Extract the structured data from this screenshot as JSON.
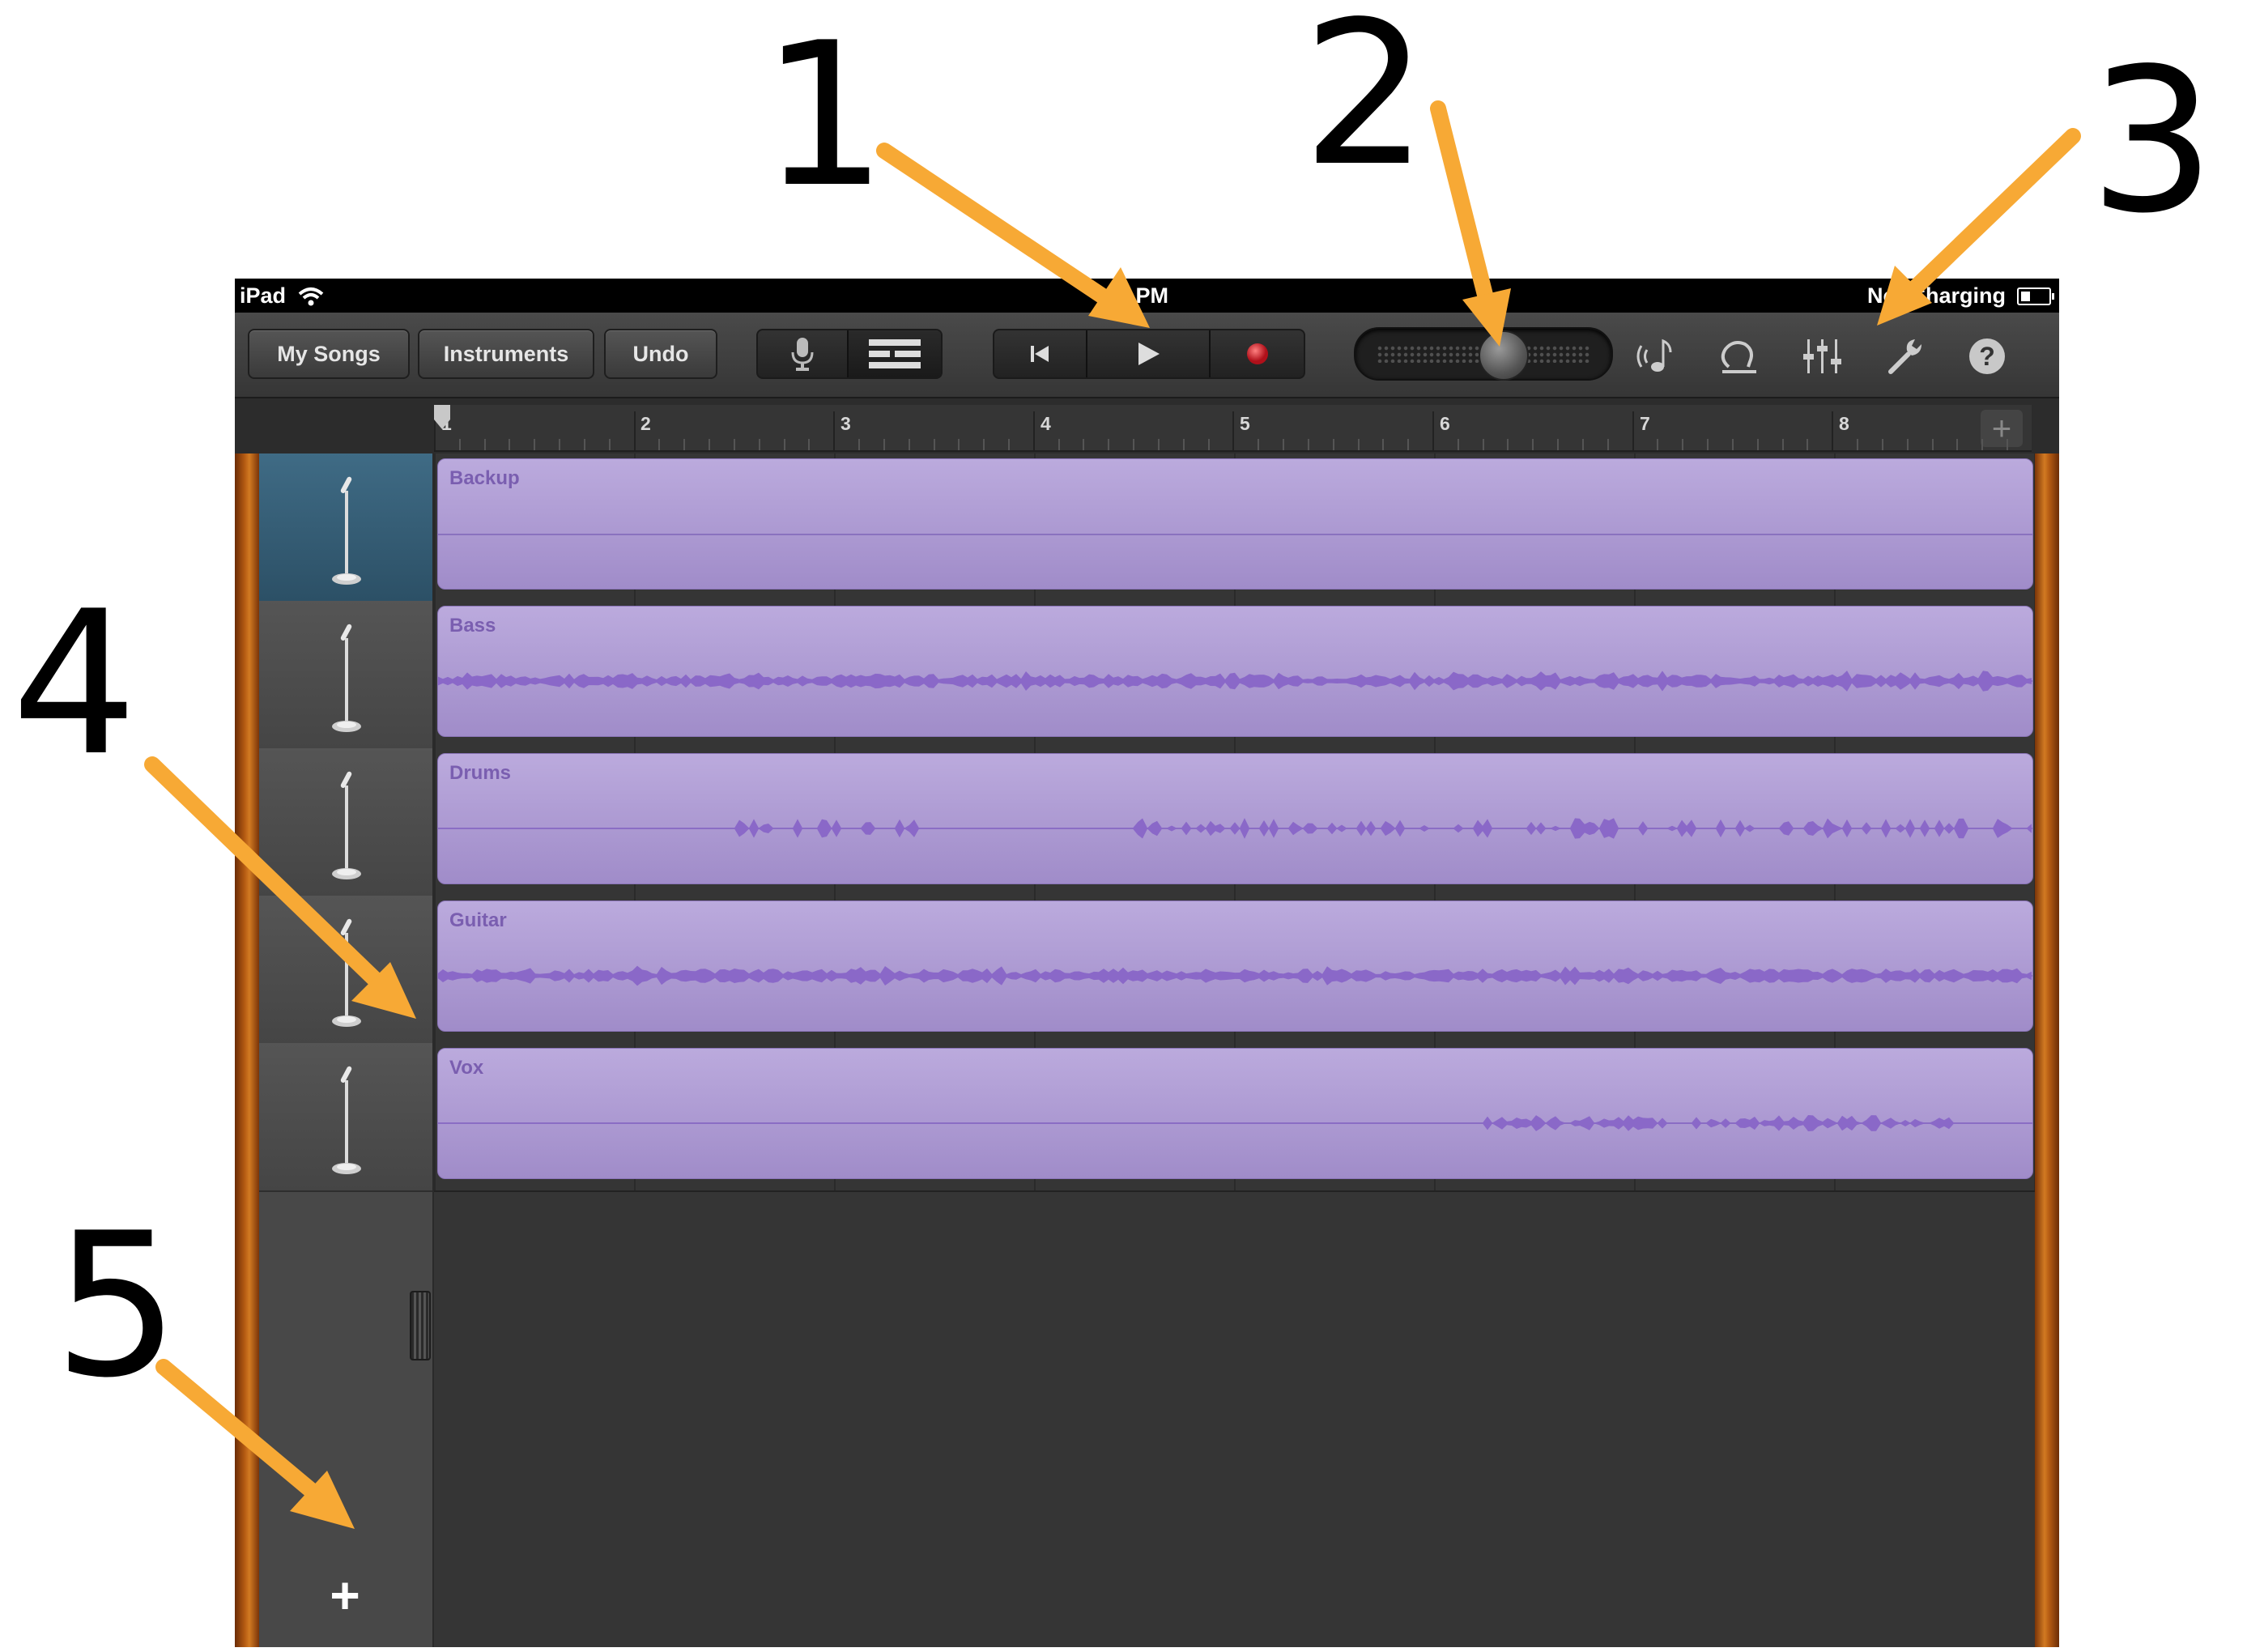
{
  "annotations": {
    "numbers": [
      "1",
      "2",
      "3",
      "4",
      "5"
    ],
    "arrow_color": "#f7a935"
  },
  "status_bar": {
    "device": "iPad",
    "time": "03 PM",
    "battery_status": "Not Charging"
  },
  "toolbar": {
    "my_songs_label": "My Songs",
    "instruments_label": "Instruments",
    "undo_label": "Undo",
    "view_toggle_icons": [
      "microphone-icon",
      "tracks-view-icon"
    ],
    "transport_icons": [
      "go-to-beginning-icon",
      "play-icon",
      "record-icon"
    ],
    "right_icons": [
      "metronome-icon",
      "loop-icon",
      "mixer-icon",
      "settings-wrench-icon",
      "help-icon"
    ],
    "help_glyph": "?"
  },
  "ruler": {
    "bars": [
      "1",
      "2",
      "3",
      "4",
      "5",
      "6",
      "7",
      "8"
    ],
    "add_section_glyph": "+"
  },
  "tracks": [
    {
      "name": "Backup",
      "selected": true,
      "waveform": "none"
    },
    {
      "name": "Bass",
      "selected": false,
      "waveform": "continuous"
    },
    {
      "name": "Drums",
      "selected": false,
      "waveform": "hits"
    },
    {
      "name": "Guitar",
      "selected": false,
      "waveform": "continuous"
    },
    {
      "name": "Vox",
      "selected": false,
      "waveform": "late"
    }
  ],
  "add_track_glyph": "+",
  "colors": {
    "region": "#a796d0",
    "region_label": "#7a5eb0",
    "selected_header": "#3f6b85",
    "record": "#e0202a",
    "wood": "#c06a1a"
  }
}
